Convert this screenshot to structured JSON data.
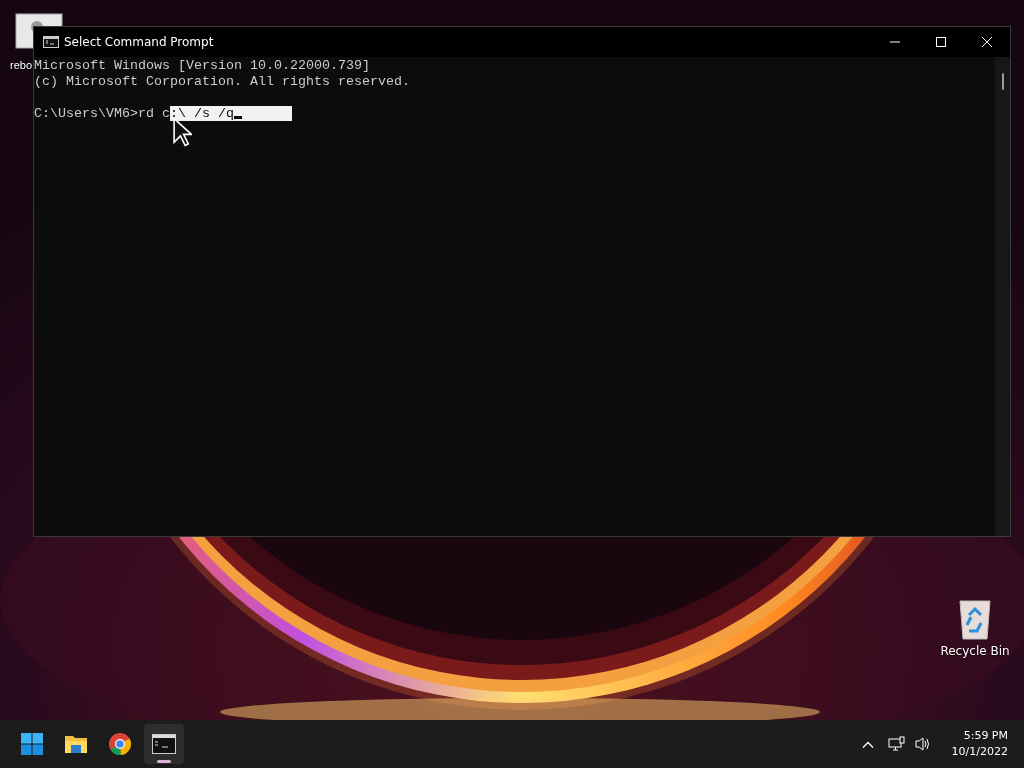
{
  "desktop_icons": [
    {
      "kind": "file",
      "label": "rebo"
    },
    {
      "kind": "recycle_bin",
      "label": "Recycle Bin"
    }
  ],
  "window": {
    "title": "Select Command Prompt",
    "lines": [
      {
        "kind": "text",
        "segments": [
          {
            "text": "Microsoft Windows [Version 10.0.22000.739]",
            "selected": false
          }
        ]
      },
      {
        "kind": "text",
        "segments": [
          {
            "text": "(c) Microsoft Corporation. All rights reserved.",
            "selected": false
          }
        ]
      },
      {
        "kind": "blank"
      },
      {
        "kind": "text",
        "segments": [
          {
            "text": "C:\\Users\\VM6>rd c",
            "selected": false
          },
          {
            "text": ":\\ /s /q",
            "selected": true
          }
        ]
      }
    ]
  },
  "taskbar": {
    "apps": [
      {
        "kind": "start",
        "active": false
      },
      {
        "kind": "folder",
        "active": false
      },
      {
        "kind": "browser",
        "active": false
      },
      {
        "kind": "terminal",
        "active": true
      }
    ],
    "clock": {
      "time": "5:59 PM",
      "date": "10/1/2022"
    }
  }
}
